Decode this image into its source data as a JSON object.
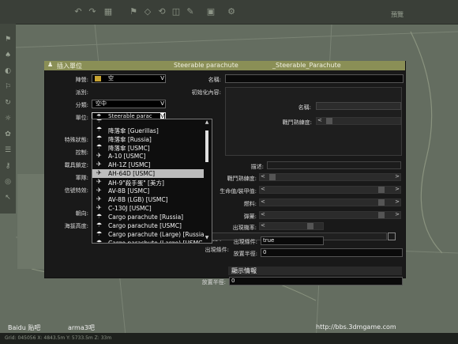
{
  "topbar": {
    "preview_label": "預覽"
  },
  "dialog": {
    "title_left": "插入單位",
    "title_mid": "Steerable parachute",
    "title_right": "_Steerable_Parachute"
  },
  "left": {
    "side_label": "陣營:",
    "side_value": "空",
    "faction_label": "派別:",
    "category_label": "分類:",
    "category_value": "空中",
    "unit_label": "單位:",
    "unit_value": "Steerable parac",
    "special_label": "特殊狀態:",
    "control_label": "控制:",
    "locked_label": "載具鎖定:",
    "formation_label": "軍隊:",
    "info_label": "信號特效:",
    "direction_label": "朝向:",
    "altitude_label": "海拔高度:"
  },
  "right": {
    "name_label": "名稱:",
    "init_label": "初始化內容:",
    "sub_name_label": "名稱:",
    "skill_label": "戰鬥熟練度:",
    "desc_label": "描述:",
    "skill2_label": "戰鬥熟練度:",
    "health_label": "生命值/裝甲值:",
    "fuel_label": "燃料:",
    "ammo_label": "彈藥:",
    "probability_label": "出現機率:",
    "condition_label": "出現條件:",
    "condition_value": "true",
    "condition_label_2": "出現條件:",
    "placement_radius_label": "放置半徑:",
    "placement_radius_value": "0",
    "probability_label_2": "機率:",
    "display_info": "顯示情報",
    "bottom_radius_label": "放置半徑:",
    "bottom_radius_value": "0"
  },
  "dropdown_items": [
    {
      "icon": "parachute-icon",
      "glyph": "☂",
      "label": "降落傘 [Guerillas]"
    },
    {
      "icon": "parachute-icon",
      "glyph": "☂",
      "label": "降落傘 [Russia]"
    },
    {
      "icon": "parachute-icon",
      "glyph": "☂",
      "label": "降落傘 [USMC]"
    },
    {
      "icon": "plane-icon",
      "glyph": "✈",
      "label": "A-10 [USMC]"
    },
    {
      "icon": "helicopter-icon",
      "glyph": "✈",
      "label": "AH-1Z [USMC]"
    },
    {
      "icon": "helicopter-icon",
      "glyph": "✈",
      "label": "AH-64D [USMC]",
      "selected": true
    },
    {
      "icon": "helicopter-icon",
      "glyph": "✈",
      "label": "AH-9\"殺手蛋\" [美方]"
    },
    {
      "icon": "plane-icon",
      "glyph": "✈",
      "label": "AV-8B [USMC]"
    },
    {
      "icon": "plane-icon",
      "glyph": "✈",
      "label": "AV-8B (LGB) [USMC]"
    },
    {
      "icon": "plane-icon",
      "glyph": "✈",
      "label": "C-130J [USMC]"
    },
    {
      "icon": "parachute-icon",
      "glyph": "☂",
      "label": "Cargo parachute [Russia]"
    },
    {
      "icon": "parachute-icon",
      "glyph": "☂",
      "label": "Cargo parachute [USMC]"
    },
    {
      "icon": "parachute-icon",
      "glyph": "☂",
      "label": "Cargo parachute (Large) [Russia"
    },
    {
      "icon": "parachute-icon",
      "glyph": "☂",
      "label": "Cargo parachute (Large) [USMC"
    }
  ],
  "watermark": {
    "baidu": "Baidu 贴吧",
    "forum": "arma3吧",
    "url": "http://bbs.3dmgame.com"
  },
  "footer": {
    "coords": "Grid: 045056   X: 4843.5m   Y: 5733.5m   Z: 33m"
  }
}
